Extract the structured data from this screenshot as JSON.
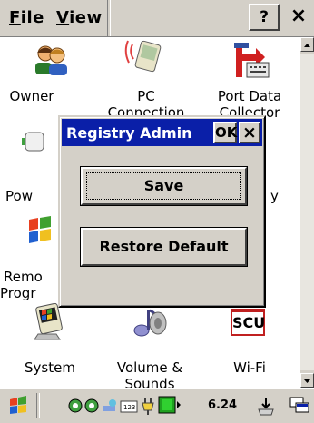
{
  "menubar": {
    "file_label": "File",
    "file_mnemonic": "F",
    "file_rest": "ile",
    "view_label": "View",
    "view_mnemonic": "V",
    "view_rest": "iew",
    "help_label": "?",
    "close_label": "×"
  },
  "icons": [
    {
      "label": "Owner",
      "icon": "owner-icon"
    },
    {
      "label": "PC Connection",
      "icon": "pc-connection-icon"
    },
    {
      "label": "Port Data Collector",
      "icon": "port-data-collector-icon"
    },
    {
      "label": "Pow",
      "icon": "power-icon"
    },
    {
      "label": "y",
      "icon": "hidden-icon"
    },
    {
      "label": "Remo Progr",
      "icon": "remove-programs-icon"
    },
    {
      "label": "System",
      "icon": "system-icon"
    },
    {
      "label": "Volume & Sounds",
      "icon": "volume-sounds-icon"
    },
    {
      "label": "Wi-Fi",
      "icon": "wifi-scu-icon"
    }
  ],
  "icon_text": {
    "owner": "Owner",
    "pc_line1": "PC",
    "pc_line2": "Connection",
    "port_line1": "Port Data",
    "port_line2": "Collector",
    "pow": "Pow",
    "y": "y",
    "remo_line1": "Remo",
    "remo_line2": "Progr",
    "system": "System",
    "volume_line1": "Volume &",
    "volume_line2": "Sounds",
    "wifi": "Wi-Fi",
    "scu_badge": "SCU"
  },
  "dialog": {
    "title": "Registry Admin",
    "ok_label": "OK",
    "close_label": "×",
    "save_label": "Save",
    "restore_label": "Restore Default"
  },
  "taskbar": {
    "clock": "6.24",
    "tray_icons": [
      "network-icon",
      "network-icon-2",
      "sync-icon",
      "keyboard-icon",
      "power-plug-icon",
      "battery-icon",
      "speaker-arrow-icon"
    ]
  },
  "colors": {
    "titlebar": "#0a1fa8",
    "chrome": "#d4d0c8"
  }
}
